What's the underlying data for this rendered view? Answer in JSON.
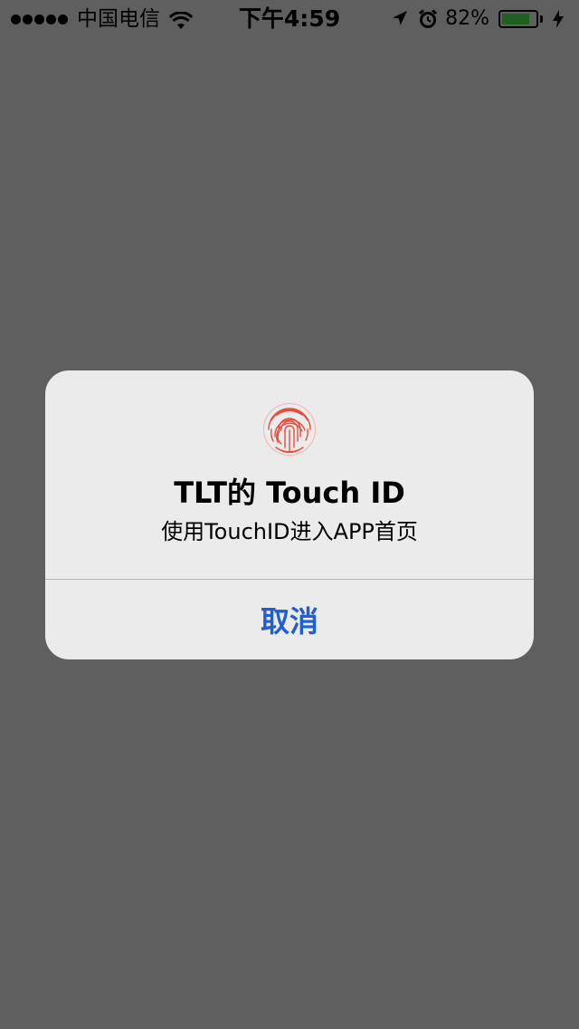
{
  "status_bar": {
    "carrier": "中国电信",
    "time": "下午4:59",
    "battery_percent_label": "82%",
    "battery_level": 0.82,
    "icons": [
      "signal-dots-icon",
      "wifi-icon",
      "location-arrow-icon",
      "alarm-clock-icon",
      "battery-icon",
      "charging-bolt-icon"
    ]
  },
  "alert": {
    "icon": "fingerprint-icon",
    "title": "TLT的 Touch ID",
    "message": "使用TouchID进入APP首页",
    "cancel_label": "取消"
  },
  "colors": {
    "dim_background": "#5f5f5f",
    "alert_background": "#ebebeb",
    "button_blue": "#1f5fd0",
    "fingerprint_red": "#e74c3c",
    "battery_fill": "#1f5f1f"
  }
}
